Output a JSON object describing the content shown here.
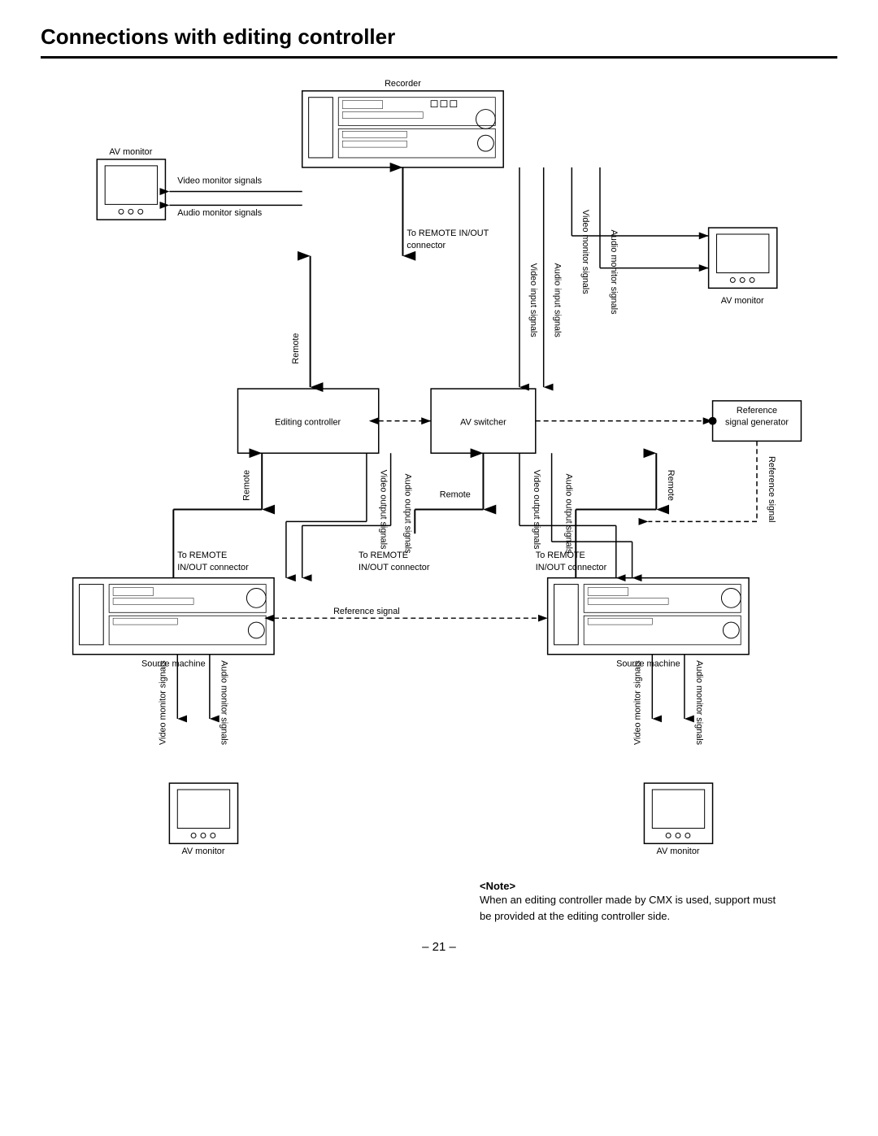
{
  "page": {
    "title": "Connections with editing controller",
    "page_number": "– 21 –"
  },
  "note": {
    "title": "<Note>",
    "text": "When an editing controller made by CMX is used, support must be provided at the editing controller side."
  },
  "labels": {
    "recorder": "Recorder",
    "av_monitor_top_left": "AV monitor",
    "av_monitor_top_right": "AV monitor",
    "av_monitor_bottom_left": "AV monitor",
    "av_monitor_bottom_right": "AV monitor",
    "source_machine_left": "Source machine",
    "source_machine_right": "Source machine",
    "editing_controller": "Editing controller",
    "av_switcher": "AV switcher",
    "reference_signal_generator": "Reference\nsignal generator",
    "video_monitor_signals_top": "Video monitor signals",
    "audio_monitor_signals_top": "Audio monitor signals",
    "to_remote_in_out": "To REMOTE IN/OUT",
    "connector": "connector",
    "remote_left": "Remote",
    "remote_bottom_left": "Remote",
    "remote_bottom_mid": "Remote",
    "video_input_signals": "Video input signals",
    "audio_input_signals": "Audio input signals",
    "video_monitor_signals_right": "Video monitor signals",
    "audio_monitor_signals_right": "Audio monitor\nsignals",
    "video_output_signals_left": "Video output signals",
    "audio_output_signals_left": "Audio output\nsignals",
    "video_output_signals_right": "Video output signals",
    "audio_output_signals_right": "Audio output signals",
    "reference_signal_right": "Reference signal",
    "to_remote_left": "To REMOTE\nIN/OUT connector",
    "to_remote_mid": "To REMOTE\nIN/OUT connector",
    "reference_signal_bottom": "Reference signal",
    "video_monitor_signals_bl": "Video monitor\nsignals",
    "audio_monitor_signals_bl": "Audio monitor\nsignals",
    "video_monitor_signals_br": "Video monitor\nsignals",
    "audio_monitor_signals_br": "Audio monitor\nsignals"
  }
}
